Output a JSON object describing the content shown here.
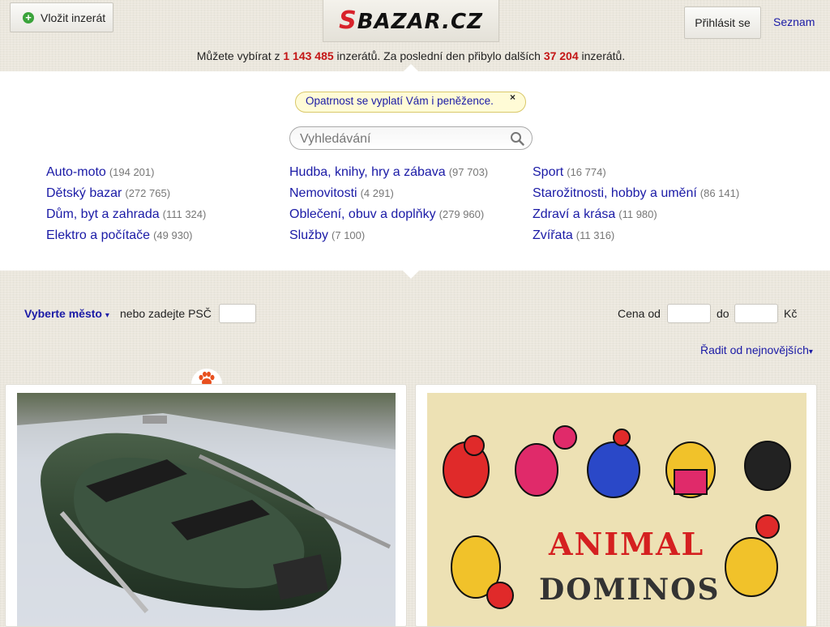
{
  "header": {
    "add_button": "Vložit inzerát",
    "logo_s": "S",
    "logo_rest": "BAZAR.CZ",
    "login_button": "Přihlásit se",
    "seznam_link": "Seznam",
    "stats": {
      "prefix": "Můžete vybírat z ",
      "total": "1 143 485",
      "middle": " inzerátů. Za poslední den přibylo dalších ",
      "new": "37 204",
      "suffix": " inzerátů."
    }
  },
  "notice": {
    "text": "Opatrnost se vyplatí Vám i peněžence.",
    "close": "×"
  },
  "search": {
    "placeholder": "Vyhledávání"
  },
  "categories": {
    "col1": [
      {
        "label": "Auto-moto",
        "count": "(194 201)"
      },
      {
        "label": "Dětský bazar",
        "count": "(272 765)"
      },
      {
        "label": "Dům, byt a zahrada",
        "count": "(111 324)"
      },
      {
        "label": "Elektro a počítače",
        "count": "(49 930)"
      }
    ],
    "col2": [
      {
        "label": "Hudba, knihy, hry a zábava",
        "count": "(97 703)"
      },
      {
        "label": "Nemovitosti",
        "count": "(4 291)"
      },
      {
        "label": "Oblečení, obuv a doplňky",
        "count": "(279 960)"
      },
      {
        "label": "Služby",
        "count": "(7 100)"
      }
    ],
    "col3": [
      {
        "label": "Sport",
        "count": "(16 774)"
      },
      {
        "label": "Starožitnosti, hobby a umění",
        "count": "(86 141)"
      },
      {
        "label": "Zdraví a krása",
        "count": "(11 980)"
      },
      {
        "label": "Zvířata",
        "count": "(11 316)"
      }
    ]
  },
  "filters": {
    "city": "Vyberte město",
    "city_arrow": "▾",
    "psc_label": "nebo zadejte PSČ",
    "price_from": "Cena od",
    "price_to": "do",
    "currency": "Kč",
    "sort": "Řadit od nejnovějších",
    "sort_arrow": "▾"
  },
  "listings": [
    {
      "image": "green inflatable boat with oars"
    },
    {
      "image": "ANIMAL DOMINOS wooden box"
    }
  ],
  "colors": {
    "link": "#1a1aa6",
    "highlight": "#c41616",
    "background": "#ebe7dd"
  }
}
